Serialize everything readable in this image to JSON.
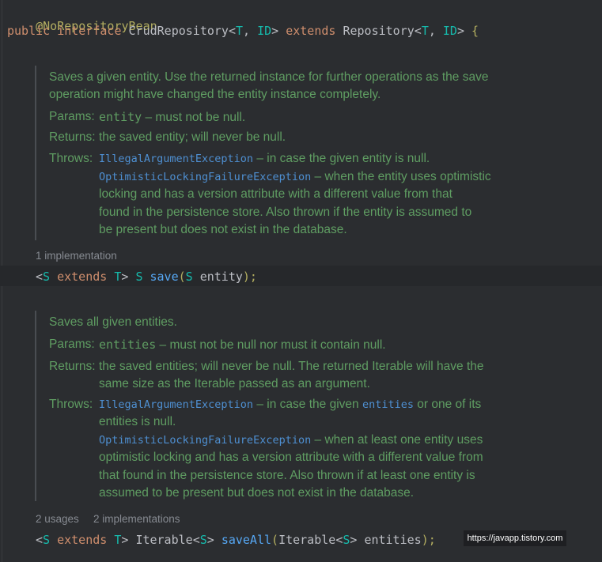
{
  "annotation": "@NoRepositoryBean",
  "decl": {
    "kw_public": "public",
    "kw_interface": "interface",
    "class_name": "CrudRepository",
    "lt": "<",
    "type_t": "T",
    "comma": ", ",
    "type_id": "ID",
    "gt": ">",
    "kw_extends": "extends",
    "parent": "Repository",
    "brace": "{"
  },
  "doc1": {
    "summary_line1": "Saves a given entity. Use the returned instance for further operations as the save",
    "summary_line2": "operation might have changed the entity instance completely.",
    "params_label": "Params:",
    "params_name": "entity",
    "params_desc": " – must not be null.",
    "returns_label": "Returns:",
    "returns_desc": "the saved entity; will never be null.",
    "throws_label": "Throws:",
    "throws1_name": "IllegalArgumentException",
    "throws1_desc": " – in case the given entity is null.",
    "throws2_name": "OptimisticLockingFailureException",
    "throws2_desc": " – when the entity uses optimistic",
    "throws2_line2": "locking and has a version attribute with a different value from that",
    "throws2_line3": "found in the persistence store. Also thrown if the entity is assumed to",
    "throws2_line4": "be present but does not exist in the database."
  },
  "meta1": {
    "implementations": "1 implementation"
  },
  "method1": {
    "lt": "<",
    "s": "S",
    "kw_extends": "extends",
    "t": "T",
    "gt": ">",
    "ret": "S",
    "name": "save",
    "open": "(",
    "ptype": "S",
    "pname": "entity",
    "close": ");"
  },
  "doc2": {
    "summary": "Saves all given entities.",
    "params_label": "Params:",
    "params_name": "entities",
    "params_desc": " – must not be null nor must it contain null.",
    "returns_label": "Returns:",
    "returns_line1": "the saved entities; will never be null. The returned Iterable will have the",
    "returns_line2": "same size as the Iterable passed as an argument.",
    "throws_label": "Throws:",
    "throws1_name": "IllegalArgumentException",
    "throws1_desc_a": " – in case the given ",
    "throws1_link": "entities",
    "throws1_desc_b": " or one of its",
    "throws1_line2": "entities is null.",
    "throws2_name": "OptimisticLockingFailureException",
    "throws2_desc": " – when at least one entity uses",
    "throws2_line2": "optimistic locking and has a version attribute with a different value from",
    "throws2_line3": "that found in the persistence store. Also thrown if at least one entity is",
    "throws2_line4": "assumed to be present but does not exist in the database."
  },
  "meta2": {
    "usages": "2 usages",
    "implementations": "2 implementations"
  },
  "method2": {
    "lt": "<",
    "s": "S",
    "kw_extends": "extends",
    "t": "T",
    "gt": ">",
    "ret": "Iterable",
    "ret_lt": "<",
    "ret_s": "S",
    "ret_gt": ">",
    "name": "saveAll",
    "open": "(",
    "ptype": "Iterable",
    "p_lt": "<",
    "p_s": "S",
    "p_gt": ">",
    "pname": "entities",
    "close": ");"
  },
  "watermark": "https://javapp.tistory.com",
  "colors": {
    "background": "#2b2d30",
    "keyword": "#cf8e6d",
    "annotation": "#b3ae60",
    "type_param": "#16baac",
    "method": "#56a8f5",
    "doc_text": "#5f9d62",
    "doc_link": "#4e8fd1"
  }
}
